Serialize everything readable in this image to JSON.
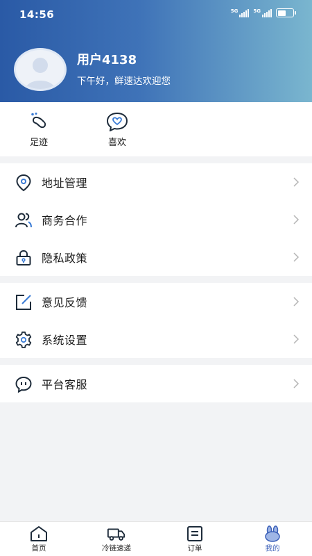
{
  "status_bar": {
    "time": "14:56",
    "network1": "5G",
    "network2": "5G"
  },
  "profile": {
    "username": "用户4138",
    "greeting": "下午好，鲜速达欢迎您"
  },
  "quick_actions": [
    {
      "label": "足迹",
      "icon": "footprint-icon"
    },
    {
      "label": "喜欢",
      "icon": "heart-chat-icon"
    }
  ],
  "menu_groups": [
    [
      {
        "label": "地址管理",
        "icon": "location-pin-icon"
      },
      {
        "label": "商务合作",
        "icon": "people-icon"
      },
      {
        "label": "隐私政策",
        "icon": "lock-icon"
      }
    ],
    [
      {
        "label": "意见反馈",
        "icon": "feedback-edit-icon"
      },
      {
        "label": "系统设置",
        "icon": "gear-icon"
      }
    ],
    [
      {
        "label": "平台客服",
        "icon": "chat-bubble-icon"
      }
    ]
  ],
  "tabbar": [
    {
      "label": "首页",
      "icon": "home-icon"
    },
    {
      "label": "冷链速递",
      "icon": "truck-icon"
    },
    {
      "label": "订单",
      "icon": "order-list-icon"
    },
    {
      "label": "我的",
      "icon": "profile-bunny-icon",
      "active": true
    }
  ],
  "colors": {
    "header_start": "#2a5aa6",
    "header_end": "#7ab6cf",
    "accent": "#3a5fb8",
    "page_bg": "#f2f3f5"
  }
}
